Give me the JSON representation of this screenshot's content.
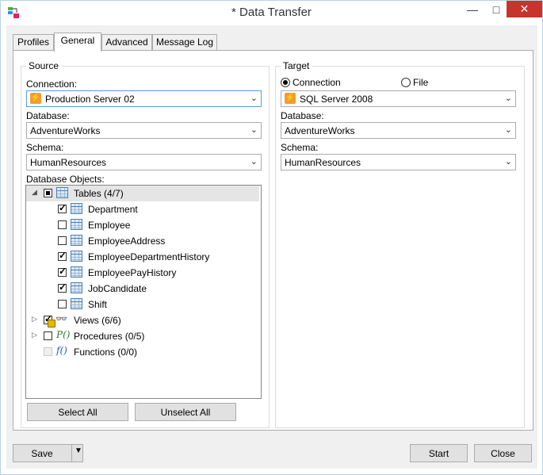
{
  "window": {
    "title": "* Data Transfer"
  },
  "title_buttons": {
    "minimize": "—",
    "maximize": "□",
    "close": "✕"
  },
  "tabs": [
    {
      "label": "Profiles",
      "active": false
    },
    {
      "label": "General",
      "active": true
    },
    {
      "label": "Advanced",
      "active": false
    },
    {
      "label": "Message Log",
      "active": false
    }
  ],
  "source": {
    "group_title": "Source",
    "connection_label": "Connection:",
    "connection_value": "Production Server 02",
    "database_label": "Database:",
    "database_value": "AdventureWorks",
    "schema_label": "Schema:",
    "schema_value": "HumanResources",
    "objects_label": "Database Objects:",
    "tree": {
      "tables": {
        "label": "Tables  (4/7)",
        "items": [
          {
            "label": "Department",
            "checked": true
          },
          {
            "label": "Employee",
            "checked": false
          },
          {
            "label": "EmployeeAddress",
            "checked": false
          },
          {
            "label": "EmployeeDepartmentHistory",
            "checked": true
          },
          {
            "label": "EmployeePayHistory",
            "checked": true
          },
          {
            "label": "JobCandidate",
            "checked": true
          },
          {
            "label": "Shift",
            "checked": false
          }
        ]
      },
      "views": {
        "label": "Views  (6/6)"
      },
      "procedures": {
        "label": "Procedures  (0/5)"
      },
      "functions": {
        "label": "Functions  (0/0)"
      }
    },
    "select_all": "Select All",
    "unselect_all": "Unselect All"
  },
  "target": {
    "group_title": "Target",
    "radio_connection": "Connection",
    "radio_file": "File",
    "connection_value": "SQL Server 2008",
    "database_label": "Database:",
    "database_value": "AdventureWorks",
    "schema_label": "Schema:",
    "schema_value": "HumanResources"
  },
  "footer": {
    "save": "Save",
    "start": "Start",
    "close": "Close"
  },
  "icons": {
    "dropdown": "chevron-down-icon",
    "expand_open": "▲",
    "expand_closed": "▷"
  },
  "colors": {
    "accent": "#569de5",
    "close_button": "#c7342b",
    "connection_icon": "#f39c2c"
  }
}
